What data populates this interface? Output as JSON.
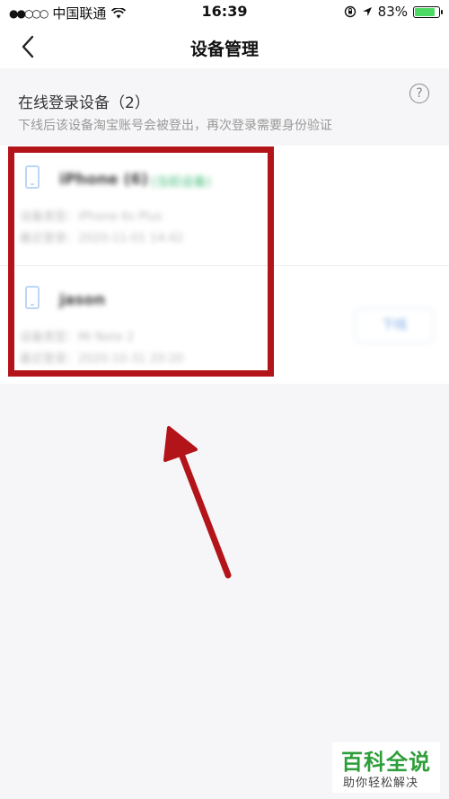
{
  "status_bar": {
    "signal": "●●○○○",
    "carrier": "中国联通",
    "wifi_icon": "wifi-icon",
    "time": "16:39",
    "battery_percent": "83%",
    "battery_level": 0.83
  },
  "nav": {
    "title": "设备管理",
    "back_icon": "chevron-left-icon"
  },
  "section": {
    "title": "在线登录设备（2）",
    "subtitle": "下线后该设备淘宝账号会被登出，再次登录需要身份验证",
    "help_symbol": "?"
  },
  "devices": [
    {
      "name": "iPhone (6)",
      "tag": "(当前设备)",
      "line1": "设备类型：iPhone 6s Plus",
      "line2": "最近登录：2020-11-01 14:42"
    },
    {
      "name": "jason",
      "line1": "设备类型：Mi Note 2",
      "line2": "最近登录：2020-10-31 20:20",
      "button": "下线"
    }
  ],
  "watermark": {
    "main": "百科全说",
    "sub": "助你轻松解决"
  },
  "colors": {
    "annotation": "#b3141a",
    "accent_blue": "#7aa6e6",
    "tag_green": "#4cbf7f",
    "watermark_green": "#2e9e3a"
  }
}
